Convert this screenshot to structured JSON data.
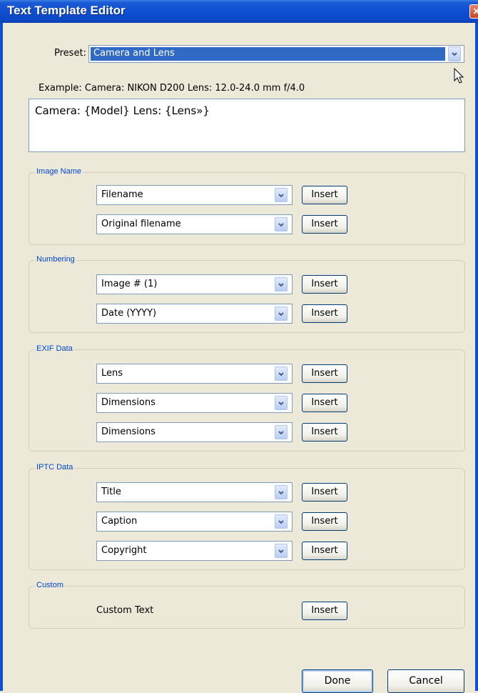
{
  "window": {
    "title": "Text Template Editor"
  },
  "preset": {
    "label": "Preset:",
    "value": "Camera and Lens"
  },
  "example": "Example: Camera: NIKON D200 Lens: 12.0-24.0 mm f/4.0",
  "template_text": "Camera: {Model} Lens: {Lens»}",
  "groups": {
    "image_name": {
      "label": "Image Name",
      "fields": [
        "Filename",
        "Original filename"
      ]
    },
    "numbering": {
      "label": "Numbering",
      "fields": [
        "Image # (1)",
        "Date (YYYY)"
      ]
    },
    "exif": {
      "label": "EXIF Data",
      "fields": [
        "Lens",
        "Dimensions",
        "Dimensions"
      ]
    },
    "iptc": {
      "label": "IPTC Data",
      "fields": [
        "Title",
        "Caption",
        "Copyright"
      ]
    },
    "custom": {
      "label": "Custom",
      "text": "Custom Text"
    }
  },
  "buttons": {
    "insert": "Insert",
    "done": "Done",
    "cancel": "Cancel"
  },
  "icons": {
    "close": "close-icon",
    "dropdown": "chevron-down-icon",
    "cursor": "mouse-pointer-icon"
  },
  "colors": {
    "titlebar": "#0f4fd1",
    "selection": "#316ac5",
    "group_label": "#0046d5",
    "dialog_bg": "#ece9d8"
  }
}
